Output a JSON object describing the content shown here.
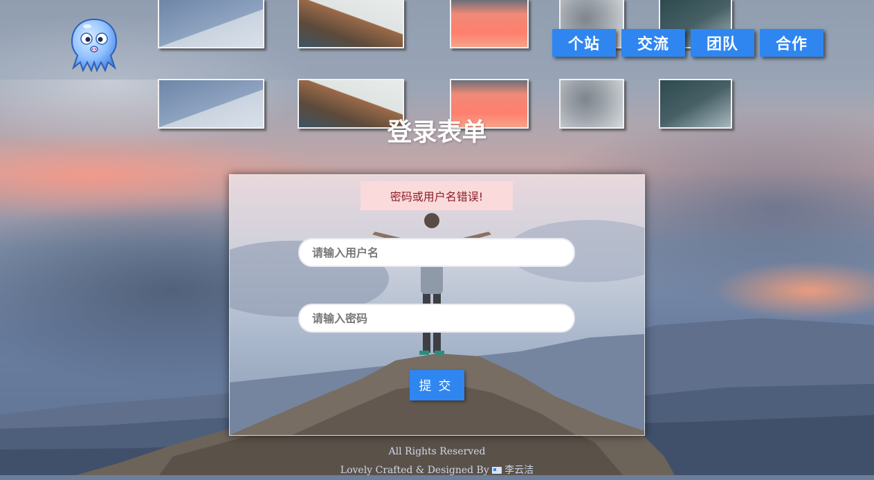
{
  "header": {
    "nav": [
      {
        "label": "个站"
      },
      {
        "label": "交流"
      },
      {
        "label": "团队"
      },
      {
        "label": "合作"
      }
    ]
  },
  "page": {
    "title": "登录表单"
  },
  "login": {
    "error_message": "密码或用户名错误!",
    "username_placeholder": "请输入用户名",
    "password_placeholder": "请输入密码",
    "submit_label": "提交"
  },
  "footer": {
    "rights": "All Rights Reserved",
    "credit_prefix": "Lovely Crafted & Designed By",
    "author": "李云洁"
  },
  "colors": {
    "accent": "#2f86f1",
    "error_bg": "#fbdadb",
    "error_text": "#8a1f28"
  },
  "icons": {
    "logo": "octopus-logo-icon",
    "author_flag": "flag-icon"
  }
}
